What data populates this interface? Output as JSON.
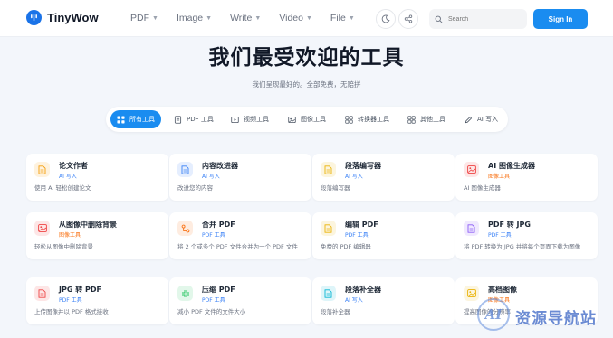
{
  "brand": {
    "name": "TinyWow"
  },
  "nav": [
    {
      "label": "PDF"
    },
    {
      "label": "Image"
    },
    {
      "label": "Write"
    },
    {
      "label": "Video"
    },
    {
      "label": "File"
    }
  ],
  "search": {
    "placeholder": "Search"
  },
  "signin": {
    "label": "Sign In"
  },
  "hero": {
    "title": "我们最受欢迎的工具",
    "subtitle": "我们呈现最好的。全部免费，无赔拼"
  },
  "tabs": [
    {
      "label": "所有工具",
      "icon": "grid-icon",
      "active": true
    },
    {
      "label": "PDF 工具",
      "icon": "pdf-icon",
      "active": false
    },
    {
      "label": "视频工具",
      "icon": "video-icon",
      "active": false
    },
    {
      "label": "图像工具",
      "icon": "image-icon",
      "active": false
    },
    {
      "label": "转换器工具",
      "icon": "converter-icon",
      "active": false
    },
    {
      "label": "其他工具",
      "icon": "apps-icon",
      "active": false
    },
    {
      "label": "AI 写入",
      "icon": "pen-icon",
      "active": false
    }
  ],
  "cards": [
    {
      "title": "论文作者",
      "tag": "AI 写入",
      "desc": "使用 AI 轻松创建论文",
      "icon": "document-icon",
      "color": "#f59e0b"
    },
    {
      "title": "内容改进器",
      "tag": "AI 写入",
      "desc": "改进您的内容",
      "icon": "document-icon",
      "color": "#3b82f6"
    },
    {
      "title": "段落编写器",
      "tag": "AI 写入",
      "desc": "段落编写器",
      "icon": "document-icon",
      "color": "#eab308"
    },
    {
      "title": "AI 图像生成器",
      "tag": "图像工具",
      "desc": "AI 图像生成器",
      "icon": "picture-icon",
      "color": "#ef4444"
    },
    {
      "title": "从图像中删除背景",
      "tag": "图像工具",
      "desc": "轻松从图像中删除背景",
      "icon": "picture-icon",
      "color": "#ef4444"
    },
    {
      "title": "合并 PDF",
      "tag": "PDF 工具",
      "desc": "将 2 个或多个 PDF 文件合并为一个 PDF 文件",
      "icon": "merge-icon",
      "color": "#f97316"
    },
    {
      "title": "编辑 PDF",
      "tag": "PDF 工具",
      "desc": "免费的 PDF 编辑器",
      "icon": "document-icon",
      "color": "#eab308"
    },
    {
      "title": "PDF 转 JPG",
      "tag": "PDF 工具",
      "desc": "将 PDF 转换为 JPG 并将每个页面下载为图像",
      "icon": "document-icon",
      "color": "#8b5cf6"
    },
    {
      "title": "JPG 转 PDF",
      "tag": "PDF 工具",
      "desc": "上传图像并以 PDF 格式接收",
      "icon": "document-icon",
      "color": "#ef4444"
    },
    {
      "title": "压缩 PDF",
      "tag": "PDF 工具",
      "desc": "减小 PDF 文件的文件大小",
      "icon": "compress-icon",
      "color": "#22c55e"
    },
    {
      "title": "段落补全器",
      "tag": "AI 写入",
      "desc": "段落补全器",
      "icon": "document-icon",
      "color": "#06b6d4"
    },
    {
      "title": "高档图像",
      "tag": "图像工具",
      "desc": "提高图像的分辨率",
      "icon": "picture-icon",
      "color": "#eab308"
    }
  ],
  "tag_colors": {
    "AI 写入": "#3b82f6",
    "图像工具": "#f97316",
    "PDF 工具": "#3b82f6"
  },
  "watermark": {
    "mark": "AI",
    "text": "资源导航站"
  }
}
